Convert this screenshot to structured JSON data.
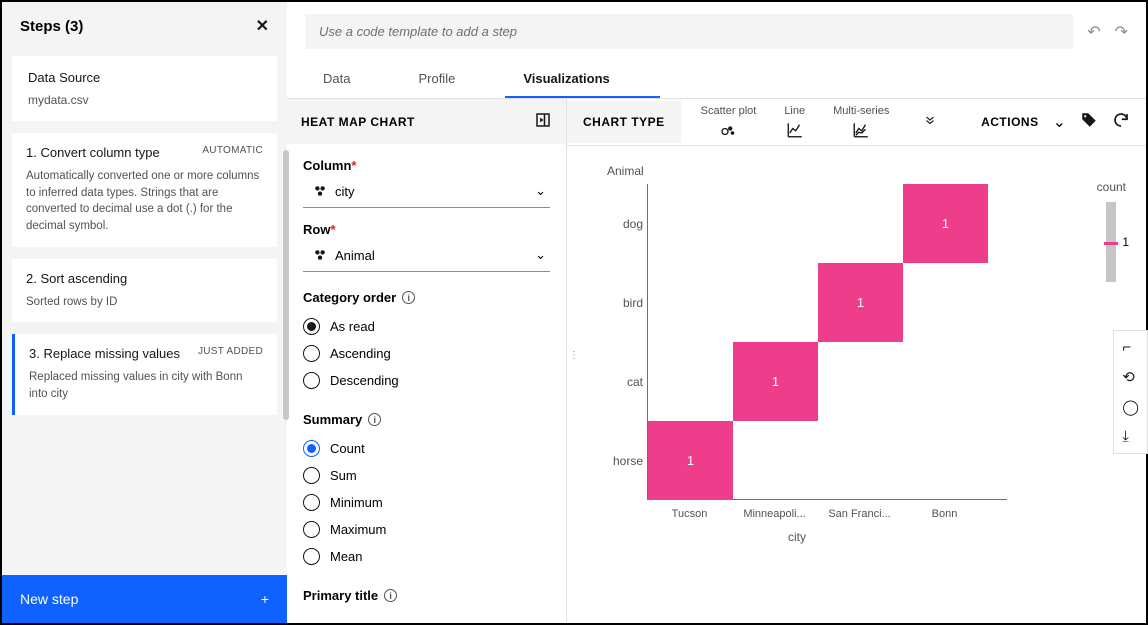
{
  "sidebar": {
    "title": "Steps (3)",
    "dataSource": {
      "label": "Data Source",
      "file": "mydata.csv"
    },
    "steps": [
      {
        "title": "1. Convert column type",
        "badge": "AUTOMATIC",
        "desc": "Automatically converted one or more columns to inferred data types. Strings that are converted to decimal use a dot (.) for the decimal symbol."
      },
      {
        "title": "2. Sort ascending",
        "badge": "",
        "desc": "Sorted rows by ID"
      },
      {
        "title": "3. Replace missing values",
        "badge": "JUST ADDED",
        "desc": "Replaced missing values in city with Bonn into city"
      }
    ],
    "newStep": "New step"
  },
  "top": {
    "placeholder": "Use a code template to add a step"
  },
  "tabs": [
    "Data",
    "Profile",
    "Visualizations"
  ],
  "cfg": {
    "heading": "HEAT MAP CHART",
    "column": {
      "label": "Column",
      "value": "city"
    },
    "row": {
      "label": "Row",
      "value": "Animal"
    },
    "categoryOrder": {
      "label": "Category order",
      "options": [
        "As read",
        "Ascending",
        "Descending"
      ],
      "selected": "As read"
    },
    "summary": {
      "label": "Summary",
      "options": [
        "Count",
        "Sum",
        "Minimum",
        "Maximum",
        "Mean"
      ],
      "selected": "Count"
    },
    "primaryTitle": "Primary title"
  },
  "chartType": {
    "label": "CHART TYPE",
    "types": [
      "Scatter plot",
      "Line",
      "Multi-series"
    ]
  },
  "actions": "ACTIONS",
  "chart_data": {
    "type": "heatmap",
    "xlabel": "city",
    "ylabel": "Animal",
    "x_categories": [
      "Tucson",
      "Minneapoli...",
      "San Franci...",
      "Bonn"
    ],
    "y_categories": [
      "dog",
      "bird",
      "cat",
      "horse"
    ],
    "cells": [
      {
        "x": "Bonn",
        "y": "dog",
        "value": 1
      },
      {
        "x": "San Franci...",
        "y": "bird",
        "value": 1
      },
      {
        "x": "Minneapoli...",
        "y": "cat",
        "value": 1
      },
      {
        "x": "Tucson",
        "y": "horse",
        "value": 1
      }
    ],
    "legend": {
      "label": "count",
      "value": 1
    }
  }
}
